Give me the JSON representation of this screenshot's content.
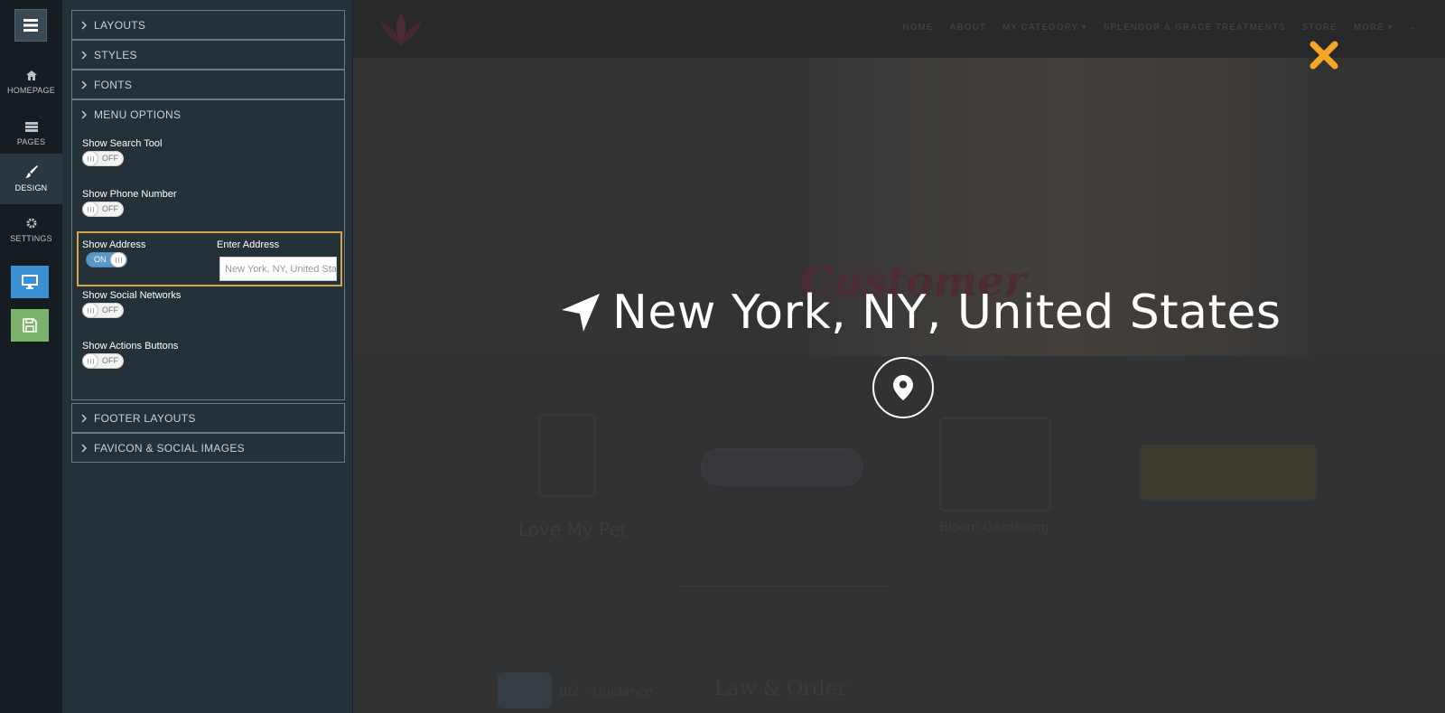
{
  "rail": {
    "items": [
      {
        "label": "HOMEPAGE"
      },
      {
        "label": "PAGES"
      },
      {
        "label": "DESIGN"
      },
      {
        "label": "SETTINGS"
      }
    ]
  },
  "panel": {
    "sections": {
      "layouts": "LAYOUTS",
      "styles": "STYLES",
      "fonts": "FONTS",
      "menu_options": "MENU OPTIONS",
      "footer_layouts": "FOOTER LAYOUTS",
      "favicon": "FAVICON & SOCIAL IMAGES"
    },
    "options": {
      "search_tool": {
        "label": "Show Search Tool",
        "state": "OFF"
      },
      "phone_number": {
        "label": "Show Phone Number",
        "state": "OFF"
      },
      "address": {
        "label": "Show Address",
        "state": "ON",
        "input_label": "Enter Address",
        "input_placeholder": "New York, NY, United States"
      },
      "social_networks": {
        "label": "Show Social Networks",
        "state": "OFF"
      },
      "action_buttons": {
        "label": "Show Actions Buttons",
        "state": "OFF"
      }
    }
  },
  "preview": {
    "nav": [
      "HOME",
      "ABOUT",
      "MY CATEGORY ▾",
      "SPLENDOR & GRACE TREATMENTS",
      "STORE",
      "MORE ▾",
      "⌄"
    ],
    "hero_word": "Customer",
    "ghost_labels": [
      "Love My Pet",
      "Bloom Gardening",
      "BIZ - Guidance",
      "Law & Order"
    ]
  },
  "overlay": {
    "address_text": "New York, NY, United States"
  },
  "colors": {
    "accent_orange": "#f5a623",
    "toggle_on": "#5a98c8",
    "highlight_border": "#d9a54a",
    "rail_blue_button": "#3b8fd3",
    "rail_green_button": "#7bb36d"
  }
}
